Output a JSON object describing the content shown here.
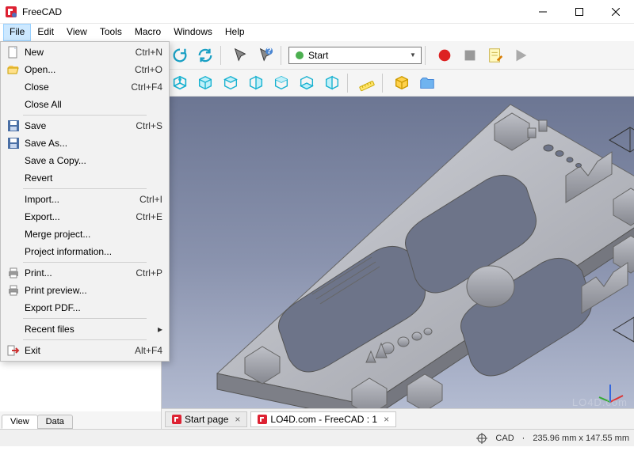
{
  "window": {
    "title": "FreeCAD"
  },
  "menubar": [
    "File",
    "Edit",
    "View",
    "Tools",
    "Macro",
    "Windows",
    "Help"
  ],
  "workspace": {
    "selected": "Start"
  },
  "file_menu": [
    {
      "label": "New",
      "shortcut": "Ctrl+N",
      "icon": "doc-new"
    },
    {
      "label": "Open...",
      "shortcut": "Ctrl+O",
      "icon": "folder-open"
    },
    {
      "label": "Close",
      "shortcut": "Ctrl+F4"
    },
    {
      "label": "Close All",
      "shortcut": ""
    },
    {
      "sep": true
    },
    {
      "label": "Save",
      "shortcut": "Ctrl+S",
      "icon": "floppy"
    },
    {
      "label": "Save As...",
      "shortcut": "",
      "icon": "floppy"
    },
    {
      "label": "Save a Copy...",
      "shortcut": ""
    },
    {
      "label": "Revert",
      "shortcut": ""
    },
    {
      "sep": true
    },
    {
      "label": "Import...",
      "shortcut": "Ctrl+I"
    },
    {
      "label": "Export...",
      "shortcut": "Ctrl+E"
    },
    {
      "label": "Merge project...",
      "shortcut": ""
    },
    {
      "label": "Project information...",
      "shortcut": ""
    },
    {
      "sep": true
    },
    {
      "label": "Print...",
      "shortcut": "Ctrl+P",
      "icon": "printer"
    },
    {
      "label": "Print preview...",
      "shortcut": "",
      "icon": "printer"
    },
    {
      "label": "Export PDF...",
      "shortcut": ""
    },
    {
      "sep": true
    },
    {
      "label": "Recent files",
      "shortcut": "",
      "submenu": true
    },
    {
      "sep": true
    },
    {
      "label": "Exit",
      "shortcut": "Alt+F4",
      "icon": "exit"
    }
  ],
  "sidebar_tabs": [
    "View",
    "Data"
  ],
  "doc_tabs": [
    {
      "label": "Start page",
      "active": false
    },
    {
      "label": "LO4D.com - FreeCAD : 1",
      "active": true
    }
  ],
  "status": {
    "mode": "CAD",
    "dims": "235.96 mm x 147.55 mm",
    "icon": "target"
  },
  "watermark": "LO4D.com"
}
